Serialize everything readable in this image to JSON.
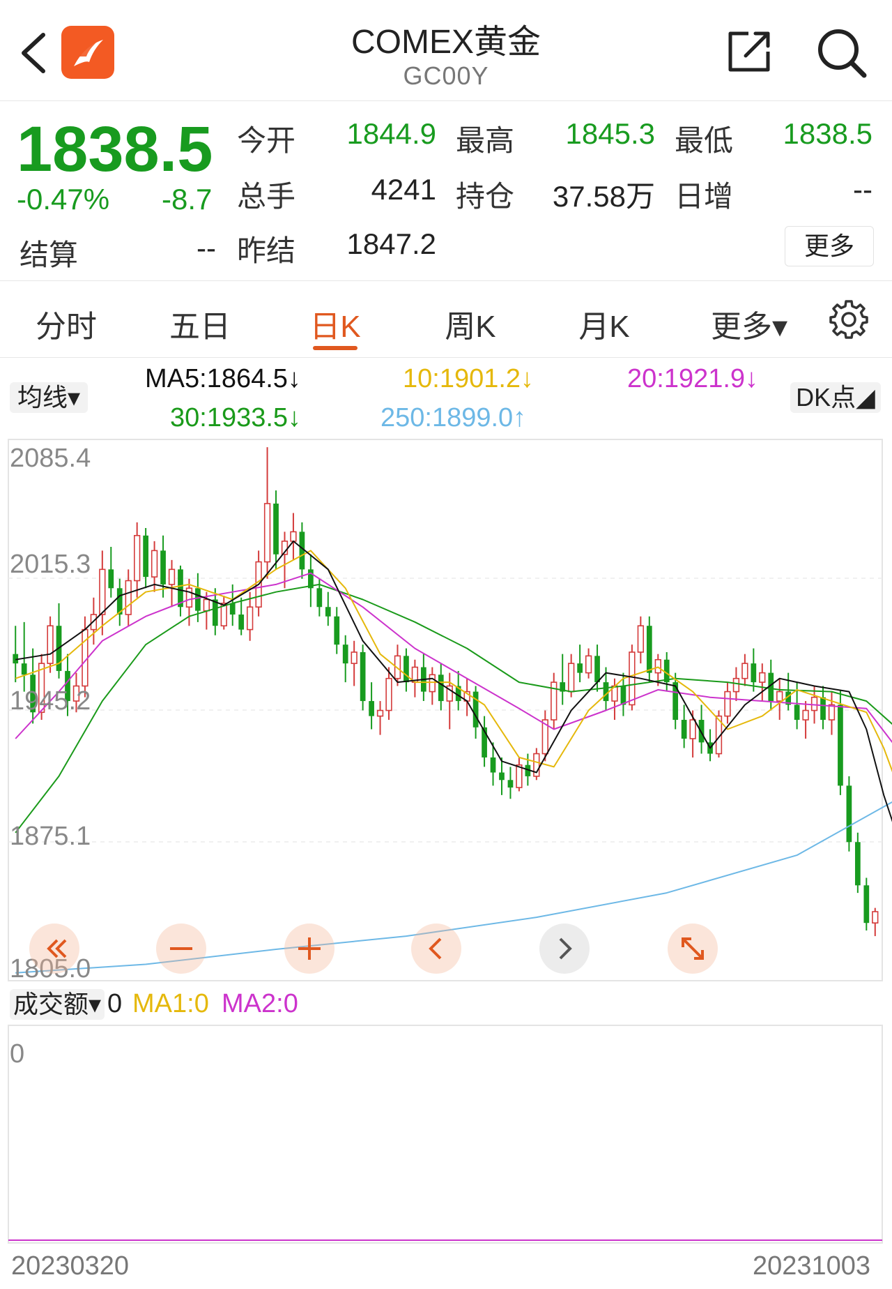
{
  "header": {
    "title": "COMEX黄金",
    "subtitle": "GC00Y"
  },
  "quote": {
    "price": "1838.5",
    "change_pct": "-0.47%",
    "change": "-8.7",
    "open_label": "今开",
    "open": "1844.9",
    "high_label": "最高",
    "high": "1845.3",
    "low_label": "最低",
    "low": "1838.5",
    "volume_label": "总手",
    "volume": "4241",
    "oi_label": "持仓",
    "oi": "37.58万",
    "daily_inc_label": "日增",
    "daily_inc": "--",
    "settle_label": "结算",
    "settle": "--",
    "prev_settle_label": "昨结",
    "prev_settle": "1847.2",
    "more_label": "更多"
  },
  "tabs": {
    "items": [
      "分时",
      "五日",
      "日K",
      "周K",
      "月K",
      "更多▾"
    ],
    "active_index": 2
  },
  "legend": {
    "indicator_select": "均线▾",
    "ma5": "MA5:1864.5↓",
    "ma10": "10:1901.2↓",
    "ma20": "20:1921.9↓",
    "ma30": "30:1933.5↓",
    "ma250": "250:1899.0↑",
    "dk_button": "DK点◢"
  },
  "volume_legend": {
    "select": "成交额▾",
    "value": "0",
    "ma1": "MA1:0",
    "ma2": "MA2:0",
    "axis_zero": "0"
  },
  "colors": {
    "up": "#d43b3b",
    "down": "#189b1f",
    "ma5": "#111111",
    "ma10": "#e5b80b",
    "ma20": "#cc33cc",
    "ma30": "#1a9a1a",
    "ma250": "#6db8e6",
    "accent": "#e0581f",
    "volume_line": "#cc33cc"
  },
  "chart_data": {
    "type": "candlestick",
    "x_start": "20230320",
    "x_end": "20231003",
    "ylim": [
      1805.0,
      2085.4
    ],
    "y_ticks": [
      "2085.4",
      "2015.3",
      "1945.2",
      "1875.1",
      "1805.0"
    ],
    "ohlc": [
      [
        1975,
        1990,
        1960,
        1970
      ],
      [
        1970,
        1992,
        1955,
        1964
      ],
      [
        1964,
        1978,
        1938,
        1944
      ],
      [
        1944,
        1975,
        1940,
        1970
      ],
      [
        1970,
        1995,
        1965,
        1990
      ],
      [
        1990,
        2002,
        1962,
        1966
      ],
      [
        1966,
        1975,
        1942,
        1950
      ],
      [
        1950,
        1965,
        1944,
        1958
      ],
      [
        1958,
        1995,
        1952,
        1988
      ],
      [
        1988,
        2005,
        1980,
        1996
      ],
      [
        1996,
        2030,
        1985,
        2020
      ],
      [
        2020,
        2032,
        2005,
        2010
      ],
      [
        2010,
        2015,
        1990,
        1996
      ],
      [
        1996,
        2020,
        1990,
        2014
      ],
      [
        2014,
        2045,
        2005,
        2038
      ],
      [
        2038,
        2042,
        2010,
        2016
      ],
      [
        2016,
        2035,
        2008,
        2030
      ],
      [
        2030,
        2038,
        2005,
        2012
      ],
      [
        2012,
        2025,
        2000,
        2020
      ],
      [
        2020,
        2022,
        1995,
        2000
      ],
      [
        2000,
        2015,
        1990,
        2010
      ],
      [
        2010,
        2018,
        1992,
        1998
      ],
      [
        1998,
        2008,
        1988,
        2004
      ],
      [
        2004,
        2010,
        1985,
        1990
      ],
      [
        1990,
        2006,
        1988,
        2002
      ],
      [
        2002,
        2012,
        1990,
        1996
      ],
      [
        1996,
        2005,
        1985,
        1988
      ],
      [
        1988,
        2008,
        1982,
        2000
      ],
      [
        2000,
        2030,
        1995,
        2024
      ],
      [
        2024,
        2085,
        2015,
        2055
      ],
      [
        2055,
        2062,
        2020,
        2028
      ],
      [
        2028,
        2040,
        2010,
        2035
      ],
      [
        2035,
        2050,
        2025,
        2040
      ],
      [
        2040,
        2045,
        2015,
        2020
      ],
      [
        2020,
        2028,
        2000,
        2010
      ],
      [
        2010,
        2015,
        1995,
        2000
      ],
      [
        2000,
        2008,
        1990,
        1995
      ],
      [
        1995,
        2000,
        1975,
        1980
      ],
      [
        1980,
        1985,
        1960,
        1970
      ],
      [
        1970,
        1982,
        1958,
        1976
      ],
      [
        1976,
        1980,
        1945,
        1950
      ],
      [
        1950,
        1960,
        1935,
        1942
      ],
      [
        1942,
        1950,
        1932,
        1945
      ],
      [
        1945,
        1968,
        1940,
        1962
      ],
      [
        1962,
        1980,
        1958,
        1974
      ],
      [
        1974,
        1978,
        1955,
        1960
      ],
      [
        1960,
        1972,
        1952,
        1968
      ],
      [
        1968,
        1975,
        1950,
        1955
      ],
      [
        1955,
        1968,
        1948,
        1964
      ],
      [
        1964,
        1970,
        1945,
        1950
      ],
      [
        1950,
        1965,
        1935,
        1958
      ],
      [
        1958,
        1966,
        1945,
        1950
      ],
      [
        1950,
        1962,
        1942,
        1955
      ],
      [
        1955,
        1958,
        1930,
        1936
      ],
      [
        1936,
        1942,
        1915,
        1920
      ],
      [
        1920,
        1928,
        1905,
        1912
      ],
      [
        1912,
        1920,
        1900,
        1908
      ],
      [
        1908,
        1915,
        1898,
        1904
      ],
      [
        1904,
        1920,
        1902,
        1916
      ],
      [
        1916,
        1922,
        1905,
        1910
      ],
      [
        1910,
        1925,
        1908,
        1922
      ],
      [
        1922,
        1945,
        1918,
        1940
      ],
      [
        1940,
        1965,
        1935,
        1960
      ],
      [
        1960,
        1975,
        1948,
        1955
      ],
      [
        1955,
        1975,
        1952,
        1970
      ],
      [
        1970,
        1980,
        1960,
        1965
      ],
      [
        1965,
        1978,
        1962,
        1974
      ],
      [
        1974,
        1980,
        1955,
        1960
      ],
      [
        1960,
        1968,
        1945,
        1950
      ],
      [
        1950,
        1962,
        1940,
        1958
      ],
      [
        1958,
        1965,
        1942,
        1948
      ],
      [
        1948,
        1980,
        1945,
        1976
      ],
      [
        1976,
        1995,
        1970,
        1990
      ],
      [
        1990,
        1995,
        1960,
        1965
      ],
      [
        1965,
        1975,
        1958,
        1972
      ],
      [
        1972,
        1976,
        1955,
        1960
      ],
      [
        1960,
        1965,
        1935,
        1940
      ],
      [
        1940,
        1948,
        1925,
        1930
      ],
      [
        1930,
        1945,
        1920,
        1940
      ],
      [
        1940,
        1948,
        1922,
        1928
      ],
      [
        1928,
        1935,
        1918,
        1922
      ],
      [
        1922,
        1945,
        1920,
        1942
      ],
      [
        1942,
        1960,
        1938,
        1955
      ],
      [
        1955,
        1968,
        1950,
        1962
      ],
      [
        1962,
        1975,
        1958,
        1970
      ],
      [
        1970,
        1978,
        1955,
        1960
      ],
      [
        1960,
        1970,
        1950,
        1965
      ],
      [
        1965,
        1972,
        1945,
        1950
      ],
      [
        1950,
        1962,
        1940,
        1955
      ],
      [
        1955,
        1965,
        1945,
        1948
      ],
      [
        1948,
        1960,
        1935,
        1940
      ],
      [
        1940,
        1950,
        1930,
        1945
      ],
      [
        1945,
        1958,
        1938,
        1952
      ],
      [
        1952,
        1958,
        1935,
        1940
      ],
      [
        1940,
        1955,
        1932,
        1948
      ],
      [
        1948,
        1956,
        1900,
        1905
      ],
      [
        1905,
        1910,
        1870,
        1875
      ],
      [
        1875,
        1880,
        1848,
        1852
      ],
      [
        1852,
        1856,
        1828,
        1832
      ],
      [
        1832,
        1840,
        1825,
        1838
      ]
    ],
    "ma5": [
      [
        0,
        1972
      ],
      [
        4,
        1975
      ],
      [
        8,
        1988
      ],
      [
        12,
        2006
      ],
      [
        16,
        2012
      ],
      [
        20,
        2008
      ],
      [
        24,
        2001
      ],
      [
        28,
        2012
      ],
      [
        32,
        2035
      ],
      [
        36,
        2020
      ],
      [
        40,
        1982
      ],
      [
        44,
        1960
      ],
      [
        48,
        1962
      ],
      [
        52,
        1950
      ],
      [
        56,
        1918
      ],
      [
        60,
        1912
      ],
      [
        64,
        1945
      ],
      [
        68,
        1965
      ],
      [
        72,
        1962
      ],
      [
        76,
        1958
      ],
      [
        80,
        1925
      ],
      [
        84,
        1948
      ],
      [
        88,
        1962
      ],
      [
        92,
        1958
      ],
      [
        96,
        1955
      ],
      [
        98,
        1935
      ],
      [
        100,
        1900
      ],
      [
        102,
        1872
      ]
    ],
    "ma10": [
      [
        0,
        1962
      ],
      [
        5,
        1970
      ],
      [
        10,
        1990
      ],
      [
        15,
        2008
      ],
      [
        20,
        2012
      ],
      [
        25,
        2004
      ],
      [
        30,
        2020
      ],
      [
        34,
        2030
      ],
      [
        38,
        2010
      ],
      [
        42,
        1975
      ],
      [
        46,
        1960
      ],
      [
        50,
        1960
      ],
      [
        54,
        1948
      ],
      [
        58,
        1920
      ],
      [
        62,
        1915
      ],
      [
        66,
        1945
      ],
      [
        70,
        1962
      ],
      [
        74,
        1968
      ],
      [
        78,
        1955
      ],
      [
        82,
        1935
      ],
      [
        86,
        1942
      ],
      [
        90,
        1956
      ],
      [
        94,
        1950
      ],
      [
        98,
        1944
      ],
      [
        100,
        1925
      ],
      [
        102,
        1900
      ]
    ],
    "ma20": [
      [
        0,
        1930
      ],
      [
        5,
        1955
      ],
      [
        10,
        1982
      ],
      [
        15,
        1995
      ],
      [
        20,
        2004
      ],
      [
        25,
        2008
      ],
      [
        30,
        2012
      ],
      [
        34,
        2018
      ],
      [
        40,
        2000
      ],
      [
        46,
        1978
      ],
      [
        52,
        1962
      ],
      [
        58,
        1946
      ],
      [
        62,
        1935
      ],
      [
        68,
        1945
      ],
      [
        74,
        1956
      ],
      [
        80,
        1952
      ],
      [
        86,
        1950
      ],
      [
        92,
        1948
      ],
      [
        98,
        1946
      ],
      [
        102,
        1921.9
      ]
    ],
    "ma30": [
      [
        0,
        1880
      ],
      [
        5,
        1910
      ],
      [
        10,
        1950
      ],
      [
        15,
        1980
      ],
      [
        20,
        1995
      ],
      [
        25,
        2002
      ],
      [
        30,
        2008
      ],
      [
        35,
        2012
      ],
      [
        40,
        2004
      ],
      [
        46,
        1992
      ],
      [
        52,
        1978
      ],
      [
        58,
        1960
      ],
      [
        64,
        1955
      ],
      [
        70,
        1958
      ],
      [
        76,
        1962
      ],
      [
        82,
        1960
      ],
      [
        88,
        1956
      ],
      [
        94,
        1955
      ],
      [
        98,
        1950
      ],
      [
        102,
        1933.5
      ]
    ],
    "ma250": [
      [
        0,
        1805.5
      ],
      [
        15,
        1810
      ],
      [
        30,
        1818
      ],
      [
        45,
        1825
      ],
      [
        60,
        1835
      ],
      [
        75,
        1848
      ],
      [
        90,
        1868
      ],
      [
        102,
        1899.0
      ]
    ]
  }
}
